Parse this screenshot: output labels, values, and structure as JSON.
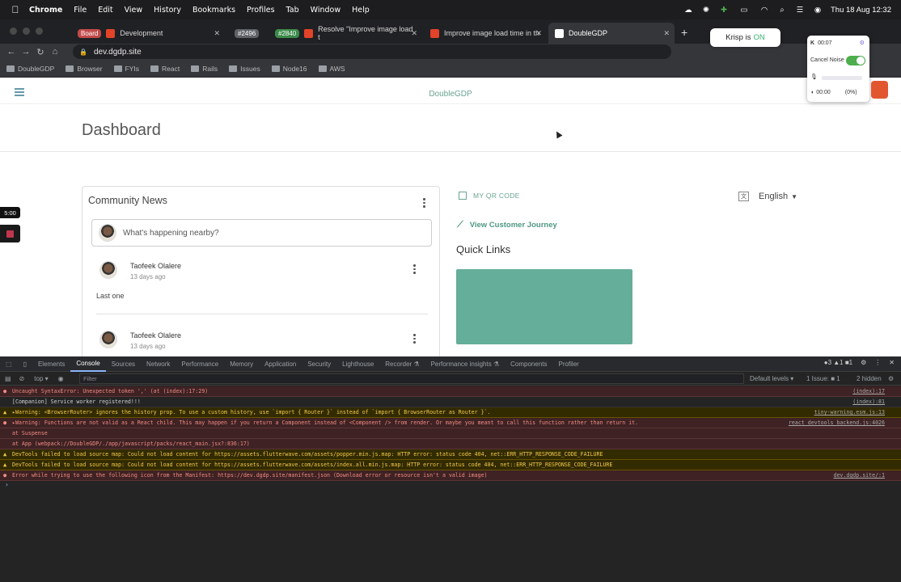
{
  "menubar": {
    "items": [
      "Chrome",
      "File",
      "Edit",
      "View",
      "History",
      "Bookmarks",
      "Profiles",
      "Tab",
      "Window",
      "Help"
    ],
    "clock": "Thu 18 Aug  12:32"
  },
  "tabs": [
    {
      "tag": "Board",
      "tag_color": "#c34a4a",
      "label": "Development"
    },
    {
      "tag": "#2496",
      "tag_color": "#3c3c3c",
      "label": ""
    },
    {
      "tag": "#2840",
      "tag_color": "#3c8a4a",
      "label": "Resolve \"Improve image load t"
    },
    {
      "tag": "",
      "tag_color": "",
      "label": "Improve image load time in th"
    },
    {
      "tag": "",
      "tag_color": "",
      "label": "DoubleGDP"
    }
  ],
  "address": {
    "url": "dev.dgdp.site"
  },
  "bookmarks": [
    "DoubleGDP",
    "Browser",
    "FYIs",
    "React",
    "Rails",
    "Issues",
    "Node16",
    "AWS"
  ],
  "krisp": {
    "pill_label": "Krisp is",
    "pill_state": "ON",
    "timer": "00:07",
    "noise_label": "Cancel Noise",
    "mic_time": "00:00",
    "mic_pct": "(0%)"
  },
  "page": {
    "brand": "DoubleGDP",
    "title": "Dashboard",
    "community": {
      "title": "Community News",
      "placeholder": "What's happening nearby?",
      "posts": [
        {
          "name": "Taofeek Olalere",
          "time": "13 days ago",
          "body": "Last one"
        },
        {
          "name": "Taofeek Olalere",
          "time": "13 days ago",
          "body": ""
        }
      ]
    },
    "qr_label": "MY QR CODE",
    "journey_label": "View Customer Journey",
    "quick_links": "Quick Links",
    "language": "English"
  },
  "recorder": {
    "timer": "5:00"
  },
  "devtools": {
    "tabs": [
      "Elements",
      "Console",
      "Sources",
      "Network",
      "Performance",
      "Memory",
      "Application",
      "Security",
      "Lighthouse",
      "Recorder ⚗",
      "Performance insights ⚗",
      "Components",
      "Profiler"
    ],
    "active_tab": "Console",
    "context": "top ▾",
    "filter_placeholder": "Filter",
    "levels": "Default levels ▾",
    "issues": "1 Issue: ■ 1",
    "hidden": "2 hidden",
    "counts": "●3 ▲1  ■1",
    "lines": [
      {
        "type": "err",
        "mark": "●",
        "text": "Uncaught SyntaxError: Unexpected token ',' (at (index):17:29)",
        "src": "(index):17"
      },
      {
        "type": "info",
        "mark": "",
        "text": "[Companion] Service worker registered!!!",
        "src": "(index):81"
      },
      {
        "type": "warn",
        "mark": "▲",
        "text": "▸Warning: <BrowserRouter> ignores the history prop. To use a custom history, use `import { Router }` instead of `import { BrowserRouter as Router }`.",
        "src": "tiny-warning.esm.js:13"
      },
      {
        "type": "err",
        "mark": "●",
        "text": "▸Warning: Functions are not valid as a React child. This may happen if you return a Component instead of <Component /> from render. Or maybe you meant to call this function rather than return it.",
        "src": "react_devtools_backend.js:4026"
      },
      {
        "type": "err",
        "mark": "",
        "text": "    at Suspense",
        "src": ""
      },
      {
        "type": "err",
        "mark": "",
        "text": "    at App (webpack://DoubleGDP/./app/javascript/packs/react_main.jsx?:836:17)",
        "src": ""
      },
      {
        "type": "warn",
        "mark": "▲",
        "text": "DevTools failed to load source map: Could not load content for https://assets.flutterwave.com/assets/popper.min.js.map: HTTP error: status code 404, net::ERR_HTTP_RESPONSE_CODE_FAILURE",
        "src": ""
      },
      {
        "type": "warn",
        "mark": "▲",
        "text": "DevTools failed to load source map: Could not load content for https://assets.flutterwave.com/assets/index.all.min.js.map: HTTP error: status code 404, net::ERR_HTTP_RESPONSE_CODE_FAILURE",
        "src": ""
      },
      {
        "type": "err",
        "mark": "●",
        "text": "Error while trying to use the following icon from the Manifest: https://dev.dgdp.site/manifest.json (Download error or resource isn't a valid image)",
        "src": "dev.dgdp.site/:1"
      }
    ]
  }
}
